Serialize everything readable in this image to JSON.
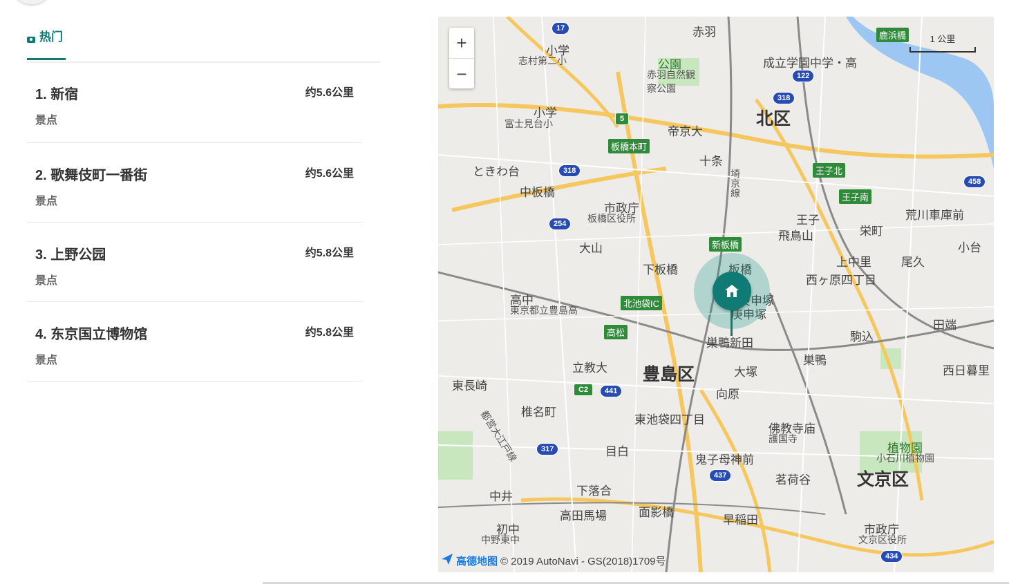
{
  "tabs": [
    {
      "label": "热门",
      "icon": "camera-icon",
      "active": true
    }
  ],
  "spots": [
    {
      "title": "1. 新宿",
      "category": "景点",
      "distance": "约5.6公里"
    },
    {
      "title": "2. 歌舞伎町一番街",
      "category": "景点",
      "distance": "约5.6公里"
    },
    {
      "title": "3. 上野公园",
      "category": "景点",
      "distance": "约5.8公里"
    },
    {
      "title": "4. 东京国立博物馆",
      "category": "景点",
      "distance": "约5.8公里"
    }
  ],
  "map": {
    "zoom_in": "+",
    "zoom_out": "−",
    "scale_label": "1 公里",
    "attribution_logo": "高德地图",
    "attribution_text": "© 2019 AutoNavi - GS(2018)1709号",
    "marker_icon": "home-icon",
    "labels": {
      "ward_kita": "北区",
      "ward_toshima": "豊島区",
      "ward_bunkyo": "文京区",
      "akabane": "赤羽",
      "jujo": "十条",
      "itabashi_honcho": "板橋本町",
      "nakaitabashi": "中板橋",
      "tokiwadai": "ときわ台",
      "itabashi_office": "市政庁",
      "itabashi_office_sub": "板橋区役所",
      "oyama": "大山",
      "shimoitabashi": "下板橋",
      "itabashi": "板橋",
      "shinitabashi": "新板橋",
      "ikebukuro_ic": "北池袋IC",
      "takamatsu": "高松",
      "rikkyo": "立教大",
      "higashinagasaki": "東長崎",
      "shiinamachi": "椎名町",
      "mejiro": "目白",
      "kishimojin": "鬼子母神前",
      "shimoochiai": "下落合",
      "nakai": "中井",
      "takadanobaba": "高田馬場",
      "omokagebashi": "面影橋",
      "waseda": "早稲田",
      "myogadani": "茗荷谷",
      "higashiikebukuro": "東池袋四丁目",
      "mukohara": "向原",
      "otsuka": "大塚",
      "sugamoshinden": "巣鴨新田",
      "sugamo": "巣鴨",
      "komagome": "駒込",
      "nishigahara": "西ヶ原四丁目",
      "koshinzuka": "新庚申塚",
      "koshinzuka2": "庚申塚",
      "oji": "王子",
      "asukayama": "飛鳥山",
      "sakaecho": "栄町",
      "kaminakazato": "上中里",
      "oku": "尾久",
      "tabata": "田端",
      "nishinippori": "西日暮里",
      "teikyo": "帝京大",
      "park_akabane": "公園",
      "park_akabane_sub": "赤羽自然観察公園",
      "jr_line": "埼京線",
      "ojikita": "王子北",
      "ojiminami": "王子南",
      "arakawa": "荒川車庫前",
      "kodai": "小台",
      "seiritsu": "成立学園中学・高",
      "kashimabashi": "鹿浜橋",
      "botanical": "植物園",
      "botanical_sub": "小石川植物園",
      "bukkyoji": "佛教寺庙",
      "bukkyoji_sub": "護国寺",
      "bunkyo_office": "市政庁",
      "bunkyo_office_sub": "文京区役所",
      "toshima_high": "高中",
      "toshima_high_sub": "東京都立豊島高",
      "oedo_line": "都営大江戸線",
      "fujimi": "小学",
      "fujimi_sub": "富士見台小",
      "shimura": "小学",
      "shimura_sub": "志村第二小",
      "nakanohigashi": "初中",
      "nakanohigashi_sub": "中野東中"
    }
  }
}
